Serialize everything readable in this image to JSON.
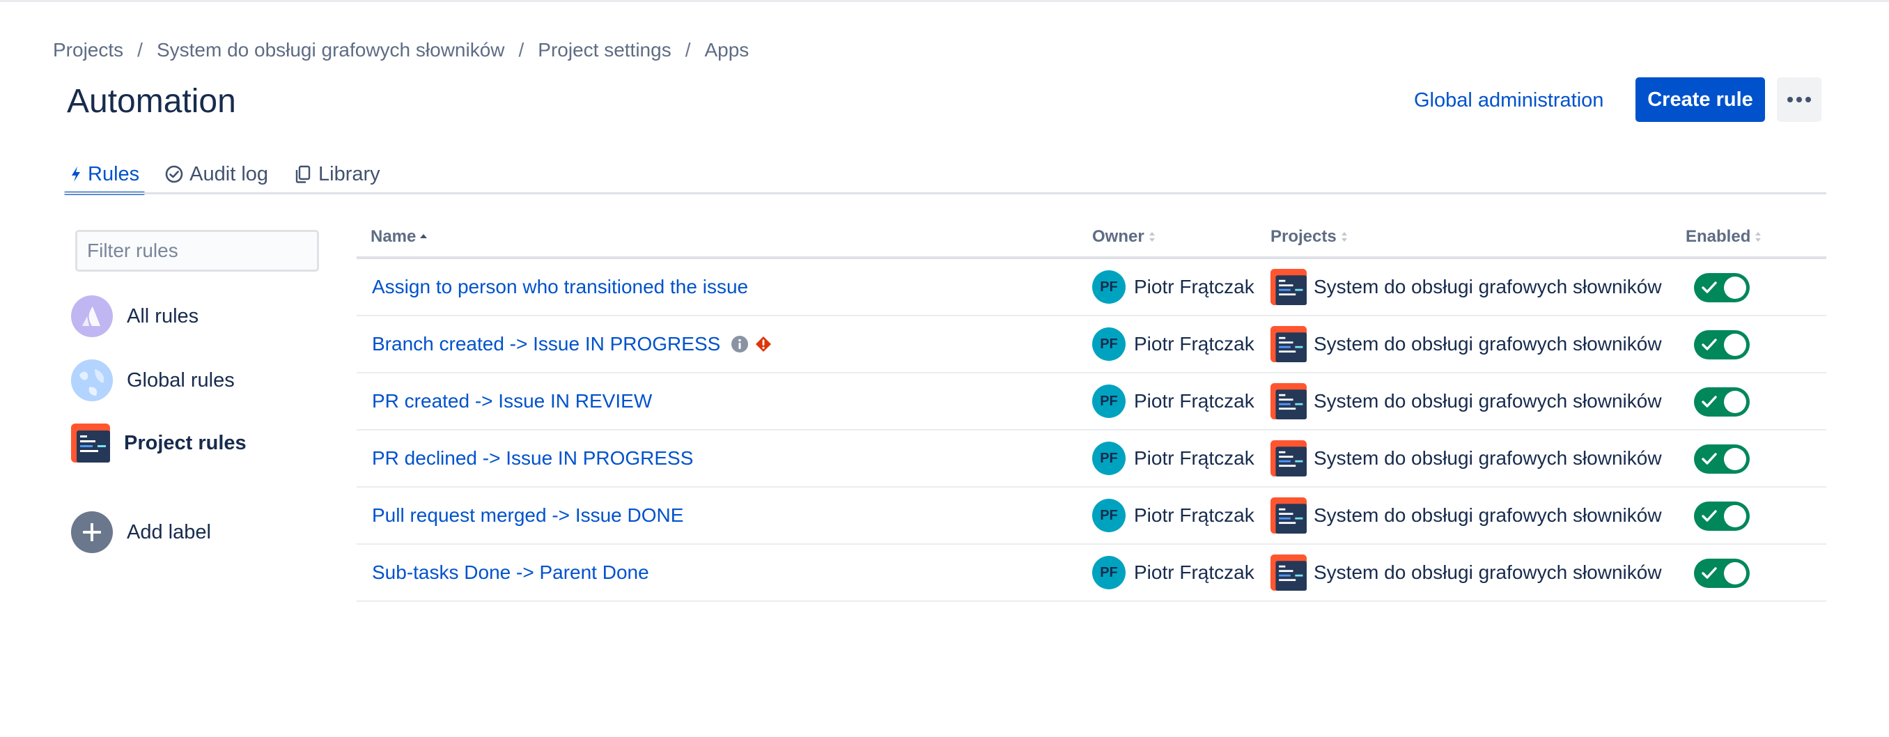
{
  "breadcrumb": {
    "items": [
      "Projects",
      "System do obsługi grafowych słowników",
      "Project settings",
      "Apps"
    ],
    "separator": "/"
  },
  "page": {
    "title": "Automation"
  },
  "header": {
    "global_admin_label": "Global administration",
    "create_rule_label": "Create rule"
  },
  "tabs": [
    {
      "label": "Rules",
      "icon": "lightning-icon",
      "active": true
    },
    {
      "label": "Audit log",
      "icon": "check-circle-icon",
      "active": false
    },
    {
      "label": "Library",
      "icon": "copy-icon",
      "active": false
    }
  ],
  "sidebar": {
    "filter_placeholder": "Filter rules",
    "items": [
      {
        "label": "All rules",
        "icon": "atlassian-icon"
      },
      {
        "label": "Global rules",
        "icon": "globe-icon"
      },
      {
        "label": "Project rules",
        "icon": "project-icon"
      },
      {
        "label": "Add label",
        "icon": "plus-icon"
      }
    ]
  },
  "table": {
    "columns": {
      "name": "Name",
      "owner": "Owner",
      "projects": "Projects",
      "enabled": "Enabled"
    },
    "rows": [
      {
        "name": "Assign to person who transitioned the issue",
        "owner": "Piotr Frątczak",
        "owner_initials": "PF",
        "project": "System do obsługi grafowych słowników",
        "enabled": true
      },
      {
        "name": "Branch created -> Issue IN PROGRESS",
        "owner": "Piotr Frątczak",
        "owner_initials": "PF",
        "project": "System do obsługi grafowych słowników",
        "enabled": true,
        "has_info": true,
        "has_warning": true
      },
      {
        "name": "PR created -> Issue IN REVIEW",
        "owner": "Piotr Frątczak",
        "owner_initials": "PF",
        "project": "System do obsługi grafowych słowników",
        "enabled": true
      },
      {
        "name": "PR declined -> Issue IN PROGRESS",
        "owner": "Piotr Frątczak",
        "owner_initials": "PF",
        "project": "System do obsługi grafowych słowników",
        "enabled": true
      },
      {
        "name": "Pull request merged -> Issue DONE",
        "owner": "Piotr Frątczak",
        "owner_initials": "PF",
        "project": "System do obsługi grafowych słowników",
        "enabled": true
      },
      {
        "name": "Sub-tasks Done -> Parent Done",
        "owner": "Piotr Frątczak",
        "owner_initials": "PF",
        "project": "System do obsługi grafowych słowników",
        "enabled": true
      }
    ]
  },
  "colors": {
    "accent": "#0052cc",
    "toggle_on": "#00875a",
    "avatar": "#00a3bf",
    "project_icon": "#ff5630",
    "warning": "#de350b"
  }
}
